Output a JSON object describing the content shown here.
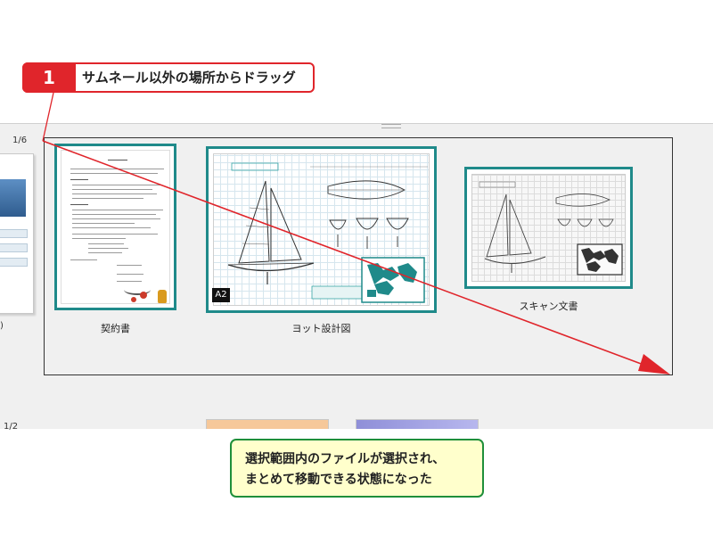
{
  "step": {
    "number": "1",
    "text": "サムネール以外の場所からドラッグ"
  },
  "groups": [
    {
      "counter": "1/6"
    },
    {
      "counter": "1/2"
    }
  ],
  "left_partial_caption": ")",
  "thumbnails": [
    {
      "caption": "契約書"
    },
    {
      "caption": "ヨット設計図",
      "badge": "A2"
    },
    {
      "caption": "スキャン文書"
    }
  ],
  "result": {
    "line1": "選択範囲内のファイルが選択され、",
    "line2": "まとめて移動できる状態になった"
  },
  "colors": {
    "accent_red": "#e0252b",
    "selection_teal": "#1f8a8a",
    "callout_green": "#1f8f3a",
    "callout_fill": "#ffffcc"
  }
}
